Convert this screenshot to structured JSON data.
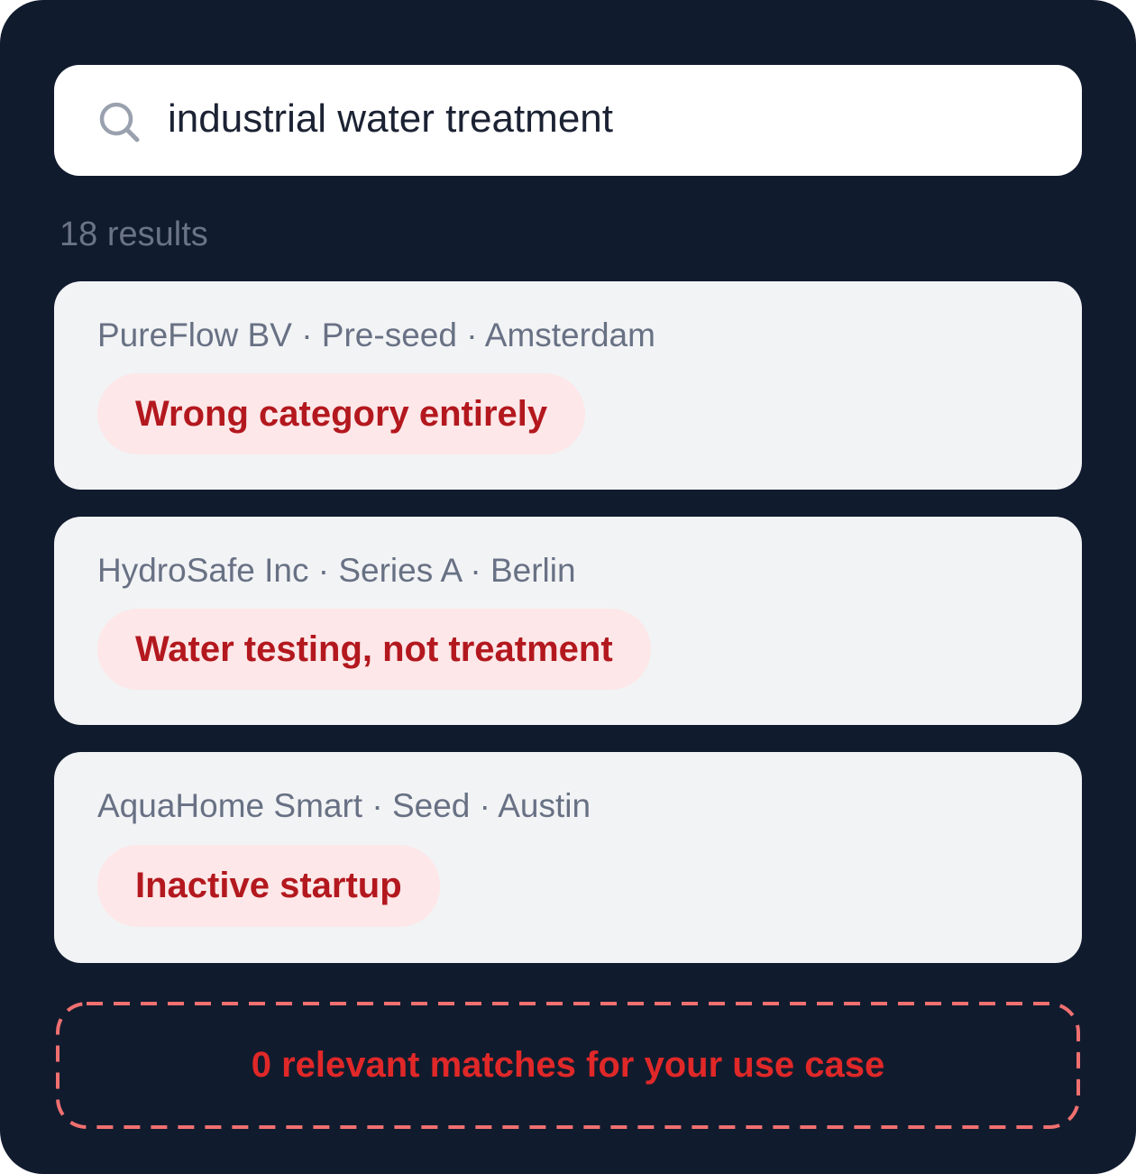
{
  "search": {
    "query": "industrial water treatment"
  },
  "results": {
    "count_label": "18 results",
    "items": [
      {
        "meta": "PureFlow BV · Pre-seed · Amsterdam",
        "tag": "Wrong category entirely"
      },
      {
        "meta": "HydroSafe Inc · Series A · Berlin",
        "tag": "Water testing, not treatment"
      },
      {
        "meta": "AquaHome Smart · Seed · Austin",
        "tag": "Inactive startup"
      }
    ]
  },
  "summary": {
    "text": "0 relevant matches for your use case"
  },
  "colors": {
    "background": "#111b2e",
    "card": "#f2f3f5",
    "tag_bg": "#fde7e8",
    "tag_text": "#b3181e",
    "alert": "#e02828",
    "alert_border": "#f07070"
  },
  "icons": {
    "search": "search-icon"
  }
}
